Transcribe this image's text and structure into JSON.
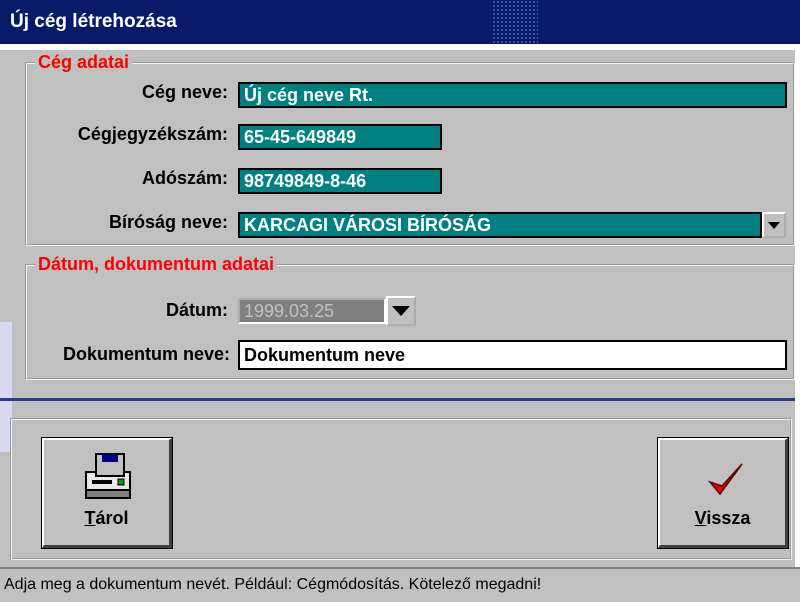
{
  "window": {
    "title": "Új cég létrehozása"
  },
  "company_group": {
    "legend": "Cég adatai",
    "name_label": "Cég neve:",
    "name_value": "Új cég neve Rt.",
    "regno_label": "Cégjegyzékszám:",
    "regno_value": "65-45-649849",
    "tax_label": "Adószám:",
    "tax_value": "98749849-8-46",
    "court_label": "Bíróság neve:",
    "court_value": "KARCAGI VÁROSI BÍRÓSÁG"
  },
  "date_group": {
    "legend": "Dátum, dokumentum adatai",
    "date_label": "Dátum:",
    "date_value": "1999.03.25",
    "doc_label": "Dokumentum neve:",
    "doc_value": "Dokumentum neve"
  },
  "buttons": {
    "store_accel": "T",
    "store_rest": "árol",
    "back_accel": "V",
    "back_rest": "issza"
  },
  "status": {
    "text": "Adja meg a dokumentum nevét. Például: Cégmódosítás. Kötelező megadni!"
  },
  "icons": {
    "store": "disk-drive-icon",
    "back": "checkmark-icon",
    "dropdown": "triangle-down-icon"
  },
  "colors": {
    "titlebar": "#0a1a6b",
    "field_teal": "#008080",
    "legend": "#ff0000"
  }
}
